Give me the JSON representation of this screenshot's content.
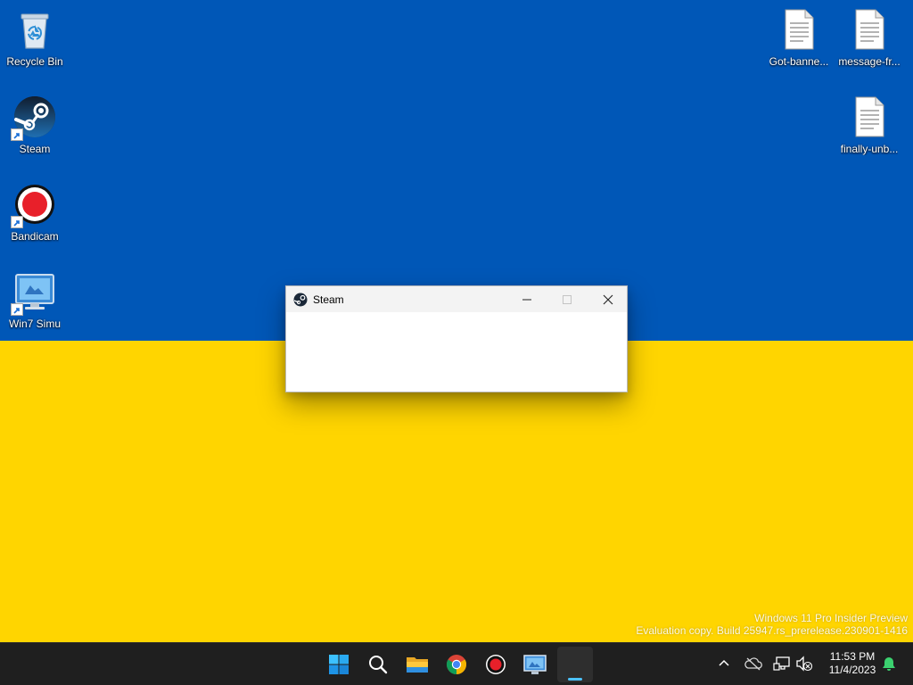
{
  "desktop": {
    "icons": [
      {
        "label": "Recycle Bin",
        "icon": "recycle-bin-icon"
      },
      {
        "label": "Steam",
        "icon": "steam-icon"
      },
      {
        "label": "Bandicam",
        "icon": "bandicam-icon"
      },
      {
        "label": "Win7 Simu",
        "icon": "win7-simu-icon"
      },
      {
        "label": "Got-banne...",
        "icon": "text-file-icon"
      },
      {
        "label": "message-fr...",
        "icon": "text-file-icon"
      },
      {
        "label": "finally-unb...",
        "icon": "text-file-icon"
      }
    ],
    "watermark": {
      "line1": "Windows 11 Pro Insider Preview",
      "line2": "Evaluation copy. Build 25947.rs_prerelease.230901-1416"
    },
    "wallpaper_colors": {
      "top": "#0057b7",
      "bottom": "#ffd500"
    }
  },
  "window": {
    "title": "Steam",
    "icon": "steam-icon"
  },
  "taskbar": {
    "apps": [
      {
        "name": "start",
        "icon": "windows-start-icon"
      },
      {
        "name": "search",
        "icon": "search-icon"
      },
      {
        "name": "file-explorer",
        "icon": "folder-icon"
      },
      {
        "name": "chrome",
        "icon": "chrome-icon"
      },
      {
        "name": "bandicam",
        "icon": "bandicam-icon"
      },
      {
        "name": "win7-simu",
        "icon": "win7-simu-icon"
      },
      {
        "name": "steam-window",
        "icon": "running-app-icon",
        "active": true
      }
    ],
    "tray": {
      "icons": [
        "chevron-up-icon",
        "onedrive-icon",
        "network-icon",
        "volume-muted-icon"
      ],
      "time": "11:53 PM",
      "date": "11/4/2023",
      "notification_icon": "bell-icon"
    },
    "accent": "#4cc2ff"
  }
}
